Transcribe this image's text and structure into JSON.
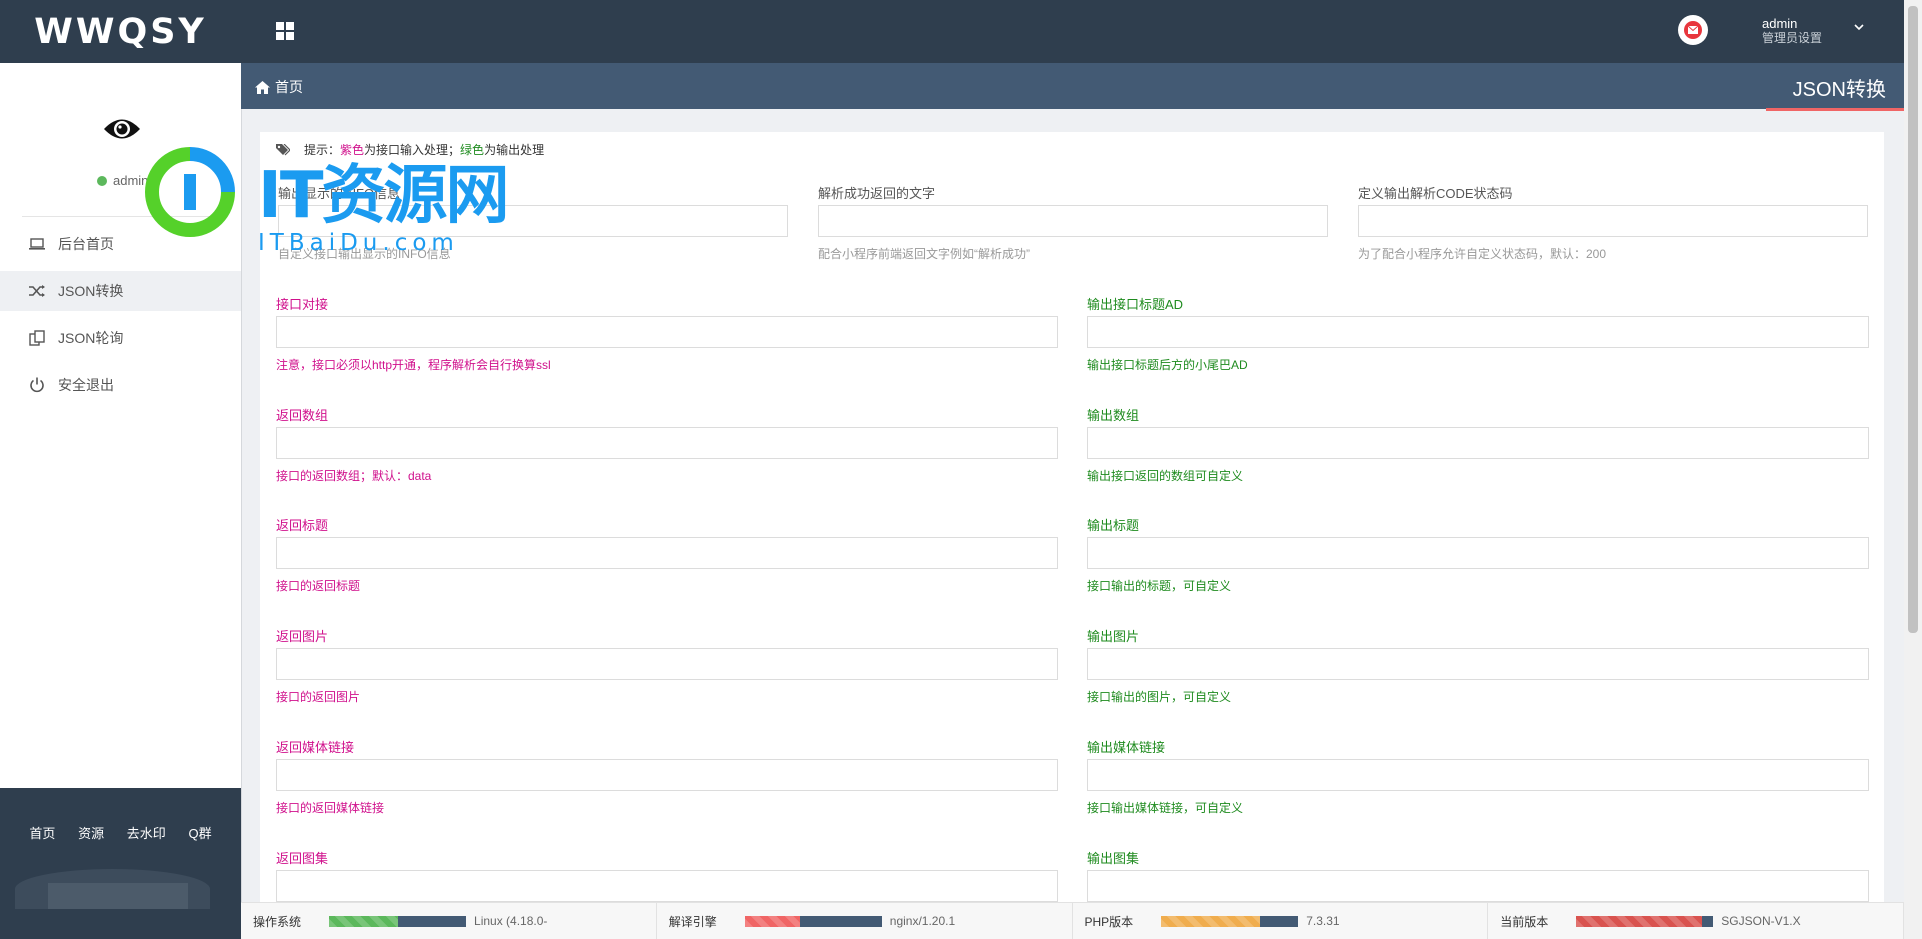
{
  "brand": {
    "logo": "WWQSY"
  },
  "sidebar": {
    "user": "admin",
    "menu": [
      {
        "label": "后台首页",
        "icon": "laptop-icon"
      },
      {
        "label": "JSON转换",
        "icon": "shuffle-icon"
      },
      {
        "label": "JSON轮询",
        "icon": "clipboard-icon"
      },
      {
        "label": "安全退出",
        "icon": "power-icon"
      }
    ],
    "active_index": 1,
    "footer_links": [
      "首页",
      "资源",
      "去水印",
      "Q群"
    ]
  },
  "header": {
    "user_name": "admin",
    "user_role": "管理员设置",
    "breadcrumb": "首页",
    "page_title": "JSON转换"
  },
  "watermark": {
    "brand": "IT资源网",
    "domain": "ITBaiDu.com"
  },
  "tip": {
    "prefix": "提示：",
    "purple_word": "紫色",
    "purple_text": "为接口输入处理；",
    "green_word": "绿色",
    "green_text": "为输出处理"
  },
  "form": {
    "top_fields": [
      {
        "label": "输出显示的INFO信息",
        "hint": "自定义接口输出显示的INFO信息"
      },
      {
        "label": "解析成功返回的文字",
        "hint": "配合小程序前端返回文字例如“解析成功”"
      },
      {
        "label": "定义输出解析CODE状态码",
        "hint": "为了配合小程序允许自定义状态码，默认：200"
      }
    ],
    "rows": [
      {
        "in_label": "接口对接",
        "in_hint": "注意，接口必须以http开通，程序解析会自行换算ssl",
        "out_label": "输出接口标题AD",
        "out_hint": "输出接口标题后方的小尾巴AD"
      },
      {
        "in_label": "返回数组",
        "in_hint": "接口的返回数组；默认：data",
        "out_label": "输出数组",
        "out_hint": "输出接口返回的数组可自定义"
      },
      {
        "in_label": "返回标题",
        "in_hint": "接口的返回标题",
        "out_label": "输出标题",
        "out_hint": "接口输出的标题，可自定义"
      },
      {
        "in_label": "返回图片",
        "in_hint": "接口的返回图片",
        "out_label": "输出图片",
        "out_hint": "接口输出的图片，可自定义"
      },
      {
        "in_label": "返回媒体链接",
        "in_hint": "接口的返回媒体链接",
        "out_label": "输出媒体链接",
        "out_hint": "接口输出媒体链接，可自定义"
      },
      {
        "in_label": "返回图集",
        "in_hint": "",
        "out_label": "输出图集",
        "out_hint": ""
      }
    ]
  },
  "status": [
    {
      "label": "操作系统",
      "value": "Linux (4.18.0-",
      "color": "#5cb85c",
      "fill_percent": 50
    },
    {
      "label": "解译引擎",
      "value": "nginx/1.20.1",
      "color": "#f06565",
      "fill_percent": 40
    },
    {
      "label": "PHP版本",
      "value": "7.3.31",
      "color": "#f0ad4e",
      "fill_percent": 72
    },
    {
      "label": "当前版本",
      "value": "SGJSON-V1.X",
      "color": "#d9534f",
      "fill_percent": 92
    }
  ]
}
